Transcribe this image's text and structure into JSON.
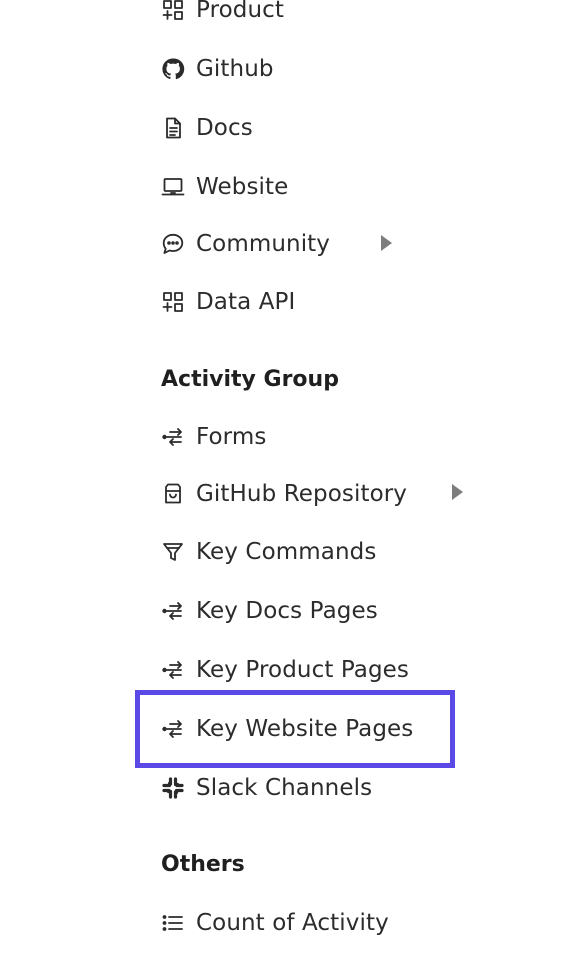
{
  "nav": {
    "items_top": [
      {
        "label": "Product",
        "icon": "grid-plus-icon"
      },
      {
        "label": "Github",
        "icon": "github-icon"
      },
      {
        "label": "Docs",
        "icon": "document-icon"
      },
      {
        "label": "Website",
        "icon": "laptop-icon"
      },
      {
        "label": "Community",
        "icon": "chat-bubble-icon"
      },
      {
        "label": "Data API",
        "icon": "grid-plus-icon"
      }
    ],
    "activity_group": {
      "heading": "Activity Group",
      "items": [
        {
          "label": "Forms",
          "icon": "flow-arrows-icon"
        },
        {
          "label": "GitHub Repository",
          "icon": "archive-box-icon"
        },
        {
          "label": "Key Commands",
          "icon": "funnel-icon"
        },
        {
          "label": "Key Docs Pages",
          "icon": "flow-arrows-icon"
        },
        {
          "label": "Key Product Pages",
          "icon": "flow-arrows-icon"
        },
        {
          "label": "Key Website Pages",
          "icon": "flow-arrows-icon"
        },
        {
          "label": "Slack Channels",
          "icon": "slack-icon"
        }
      ]
    },
    "others": {
      "heading": "Others",
      "items": [
        {
          "label": "Count of Activity",
          "icon": "list-icon"
        }
      ]
    },
    "highlight_color": "#5b49e6"
  }
}
